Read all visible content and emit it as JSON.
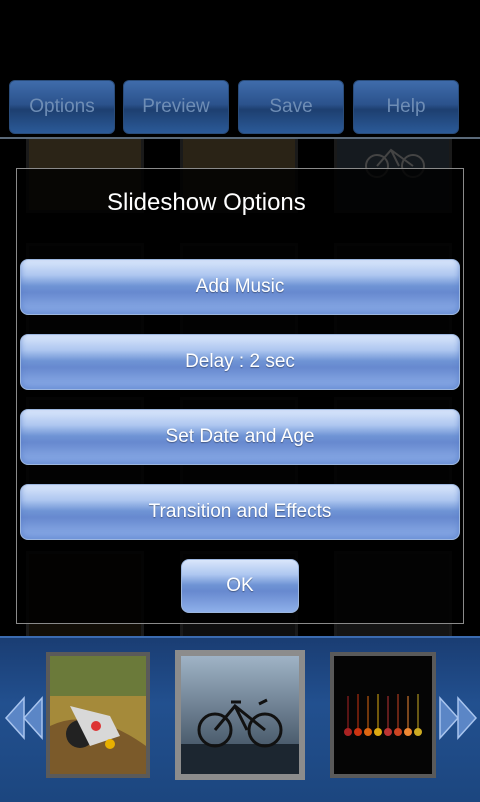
{
  "toolbar": {
    "buttons": [
      {
        "label": "Options"
      },
      {
        "label": "Preview"
      },
      {
        "label": "Save"
      },
      {
        "label": "Help"
      }
    ]
  },
  "dialog": {
    "title": "Slideshow Options",
    "options": [
      {
        "label": "Add Music"
      },
      {
        "label": "Delay : 2 sec"
      },
      {
        "label": "Set Date and Age"
      },
      {
        "label": "Transition and Effects"
      }
    ],
    "ok_label": "OK"
  },
  "colors": {
    "toolbar_button": "#2b528c",
    "dialog_button": "#6f94d5",
    "bottom_strip": "#22508f"
  }
}
